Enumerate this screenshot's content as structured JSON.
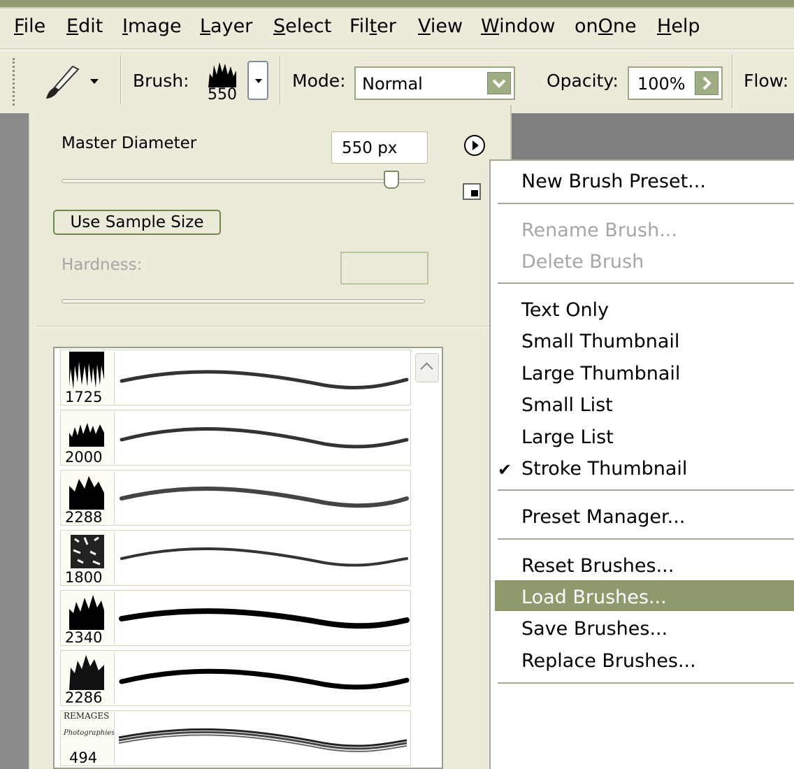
{
  "menubar": {
    "items": [
      {
        "label": "File",
        "underline": "F",
        "rest": "ile"
      },
      {
        "label": "Edit",
        "underline": "E",
        "rest": "dit"
      },
      {
        "label": "Image",
        "underline": "I",
        "rest": "mage"
      },
      {
        "label": "Layer",
        "underline": "L",
        "rest": "ayer"
      },
      {
        "label": "Select",
        "underline": "S",
        "rest": "elect"
      },
      {
        "label": "Filter",
        "pre": "Fil",
        "underline": "t",
        "rest": "er"
      },
      {
        "label": "View",
        "underline": "V",
        "rest": "iew"
      },
      {
        "label": "Window",
        "underline": "W",
        "rest": "indow"
      },
      {
        "label": "onOne",
        "pre": "on",
        "underline": "O",
        "rest": "ne"
      },
      {
        "label": "Help",
        "underline": "H",
        "rest": "elp"
      }
    ]
  },
  "options": {
    "brush_label": "Brush:",
    "brush_size": "550",
    "mode_label": "Mode:",
    "mode_value": "Normal",
    "opacity_label": "Opacity:",
    "opacity_value": "100%",
    "flow_label": "Flow:"
  },
  "brush_panel": {
    "master_diameter_label": "Master Diameter",
    "master_diameter_value": "550 px",
    "use_sample_size_label": "Use Sample Size",
    "hardness_label": "Hardness:",
    "presets": [
      {
        "size": "1725"
      },
      {
        "size": "2000"
      },
      {
        "size": "2288"
      },
      {
        "size": "1800"
      },
      {
        "size": "2340"
      },
      {
        "size": "2286"
      },
      {
        "size": "494",
        "thumb_text_1": "REMAGES",
        "thumb_text_2": "Photographies"
      }
    ]
  },
  "context_menu": {
    "new_brush_preset": "New Brush Preset...",
    "rename_brush": "Rename Brush...",
    "delete_brush": "Delete Brush",
    "text_only": "Text Only",
    "small_thumbnail": "Small Thumbnail",
    "large_thumbnail": "Large Thumbnail",
    "small_list": "Small List",
    "large_list": "Large List",
    "stroke_thumbnail": "Stroke Thumbnail",
    "preset_manager": "Preset Manager...",
    "reset_brushes": "Reset Brushes...",
    "load_brushes": "Load Brushes...",
    "save_brushes": "Save Brushes...",
    "replace_brushes": "Replace Brushes...",
    "checked_item": "Stroke Thumbnail",
    "highlighted_item": "Load Brushes..."
  },
  "colors": {
    "menu_highlight": "#8e9a6c",
    "panel_bg": "#ecead9",
    "accent_green": "#9eae82"
  }
}
